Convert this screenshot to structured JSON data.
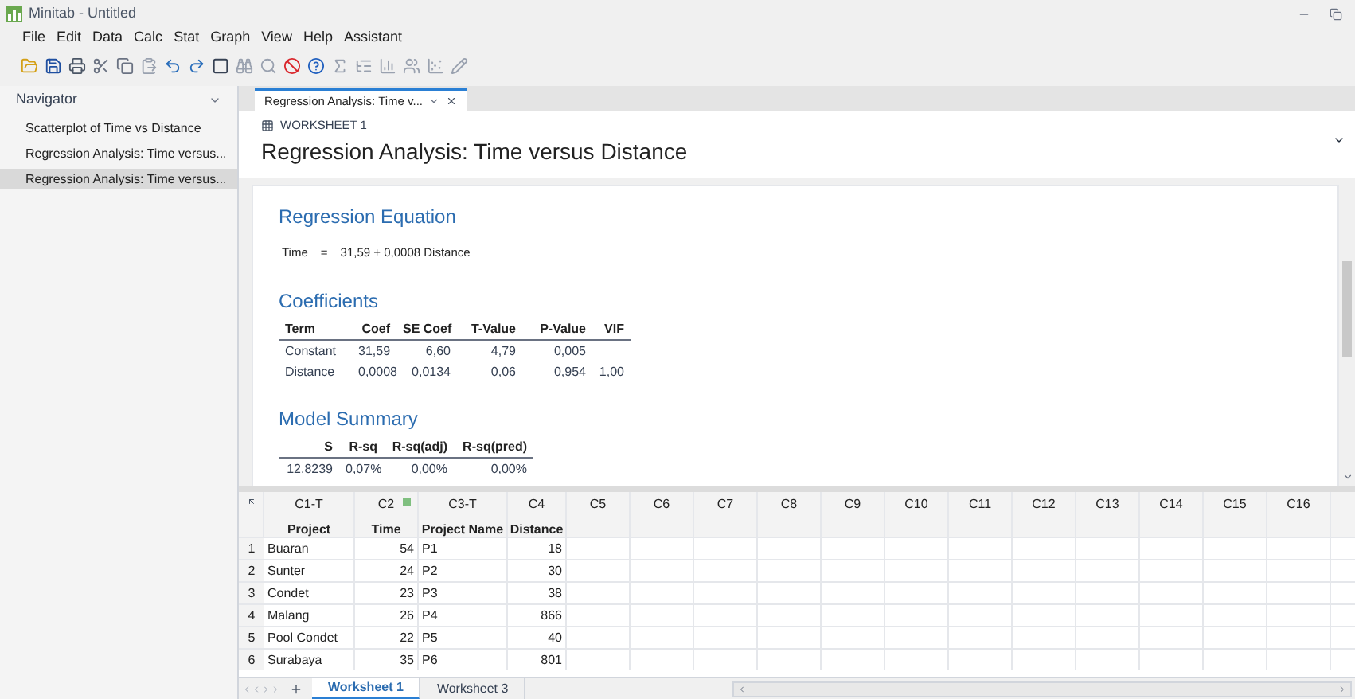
{
  "window": {
    "title": "Minitab - Untitled"
  },
  "menu": [
    "File",
    "Edit",
    "Data",
    "Calc",
    "Stat",
    "Graph",
    "View",
    "Help",
    "Assistant"
  ],
  "navigator": {
    "title": "Navigator",
    "items": [
      {
        "label": "Scatterplot of Time vs Distance",
        "selected": false
      },
      {
        "label": "Regression Analysis: Time versus...",
        "selected": false
      },
      {
        "label": "Regression Analysis: Time versus...",
        "selected": true
      }
    ]
  },
  "output_tab": {
    "label": "Regression Analysis: Time v..."
  },
  "report": {
    "worksheet_label": "WORKSHEET 1",
    "title": "Regression Analysis: Time versus Distance",
    "equation": {
      "heading": "Regression Equation",
      "lhs": "Time",
      "sign": "=",
      "rhs": "31,59 + 0,0008 Distance"
    },
    "coefficients": {
      "heading": "Coefficients",
      "columns": [
        "Term",
        "Coef",
        "SE Coef",
        "T-Value",
        "P-Value",
        "VIF"
      ],
      "rows": [
        [
          "Constant",
          "31,59",
          "6,60",
          "4,79",
          "0,005",
          ""
        ],
        [
          "Distance",
          "0,0008",
          "0,0134",
          "0,06",
          "0,954",
          "1,00"
        ]
      ]
    },
    "model_summary": {
      "heading": "Model Summary",
      "columns": [
        "S",
        "R-sq",
        "R-sq(adj)",
        "R-sq(pred)"
      ],
      "rows": [
        [
          "12,8239",
          "0,07%",
          "0,00%",
          "0,00%"
        ]
      ]
    }
  },
  "worksheet": {
    "columns": [
      {
        "id": "C1-T",
        "name": "Project",
        "kind": "text"
      },
      {
        "id": "C2",
        "name": "Time",
        "kind": "numeric"
      },
      {
        "id": "C3-T",
        "name": "Project Name",
        "kind": "text"
      },
      {
        "id": "C4",
        "name": "Distance",
        "kind": "numeric"
      },
      {
        "id": "C5"
      },
      {
        "id": "C6"
      },
      {
        "id": "C7"
      },
      {
        "id": "C8"
      },
      {
        "id": "C9"
      },
      {
        "id": "C10"
      },
      {
        "id": "C11"
      },
      {
        "id": "C12"
      },
      {
        "id": "C13"
      },
      {
        "id": "C14"
      },
      {
        "id": "C15"
      },
      {
        "id": "C16"
      }
    ],
    "rows": [
      {
        "number": "1",
        "cells": [
          "Buaran",
          "54",
          "P1",
          "18"
        ]
      },
      {
        "number": "2",
        "cells": [
          "Sunter",
          "24",
          "P2",
          "30"
        ]
      },
      {
        "number": "3",
        "cells": [
          "Condet",
          "23",
          "P3",
          "38"
        ]
      },
      {
        "number": "4",
        "cells": [
          "Malang",
          "26",
          "P4",
          "866"
        ]
      },
      {
        "number": "5",
        "cells": [
          "Pool Condet",
          "22",
          "P5",
          "40"
        ]
      },
      {
        "number": "6",
        "cells": [
          "Surabaya",
          "35",
          "P6",
          "801"
        ]
      }
    ]
  },
  "sheet_tabs": [
    {
      "label": "Worksheet 1",
      "selected": true
    },
    {
      "label": "Worksheet 3",
      "selected": false
    }
  ]
}
